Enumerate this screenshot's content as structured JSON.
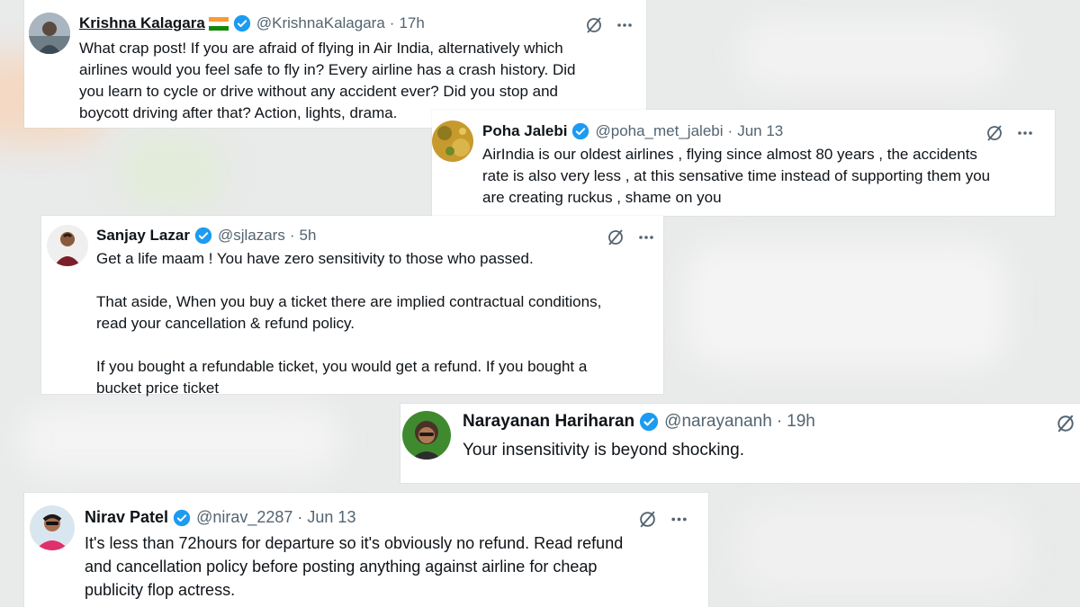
{
  "tweets": [
    {
      "name": "Krishna Kalagara",
      "handle": "@KrishnaKalagara",
      "time": "17h",
      "lines": [
        "What crap post! If you are afraid of flying in Air India, alternatively which",
        "airlines would you feel safe to fly in? Every airline has a crash history. Did",
        "you learn to cycle or drive without any accident ever? Did you stop and",
        "boycott driving after that? Action, lights, drama."
      ]
    },
    {
      "name": "Poha Jalebi",
      "handle": "@poha_met_jalebi",
      "time": "Jun 13",
      "lines": [
        "AirIndia is our oldest airlines , flying since  almost 80 years , the accidents",
        "rate is also very less , at this sensative time instead of supporting them you",
        "are creating ruckus , shame on you"
      ]
    },
    {
      "name": "Sanjay Lazar",
      "handle": "@sjlazars",
      "time": "5h",
      "lines": [
        "Get a life maam ! You have zero sensitivity to those who passed.",
        "That aside, When you buy a ticket there are implied contractual conditions,",
        "read your cancellation & refund policy.",
        "If you bought a refundable ticket, you would get a refund. If you bought a",
        "bucket price ticket"
      ]
    },
    {
      "name": "Narayanan Hariharan",
      "handle": "@narayananh",
      "time": "19h",
      "lines": [
        "Your insensitivity is beyond shocking."
      ]
    },
    {
      "name": "Nirav Patel",
      "handle": "@nirav_2287",
      "time": "Jun 13",
      "lines": [
        "It's less than 72hours for departure so it's obviously no refund. Read refund",
        "and cancellation policy before posting anything against airline for cheap",
        "publicity flop actress."
      ]
    }
  ],
  "icons": {
    "verified": "verified-badge-icon",
    "grok": "grok-icon",
    "more": "more-options-icon"
  },
  "colors": {
    "verified_blue": "#1d9bf0",
    "text": "#0f1419",
    "muted": "#536471"
  }
}
